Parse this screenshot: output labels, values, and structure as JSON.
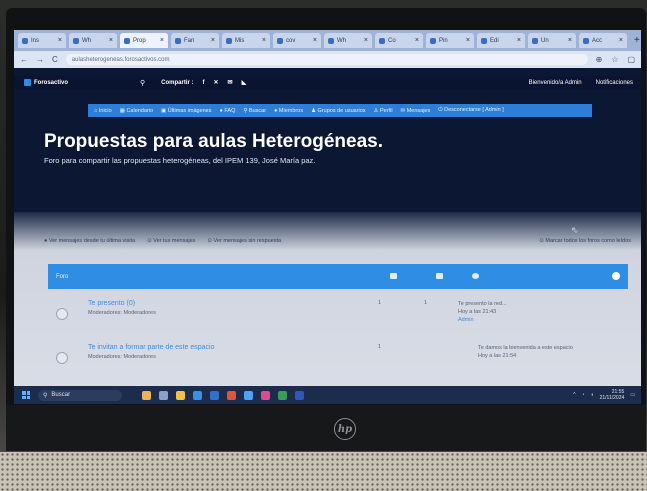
{
  "browser": {
    "tabs": [
      {
        "label": "Ins",
        "icon": "page-icon",
        "active": false
      },
      {
        "label": "Wh",
        "icon": "gmail-icon",
        "active": false
      },
      {
        "label": "Prop",
        "icon": "forum-icon",
        "active": true
      },
      {
        "label": "Fan",
        "icon": "page-icon",
        "active": false
      },
      {
        "label": "Mis",
        "icon": "page-icon",
        "active": false
      },
      {
        "label": "cov",
        "icon": "page-icon",
        "active": false
      },
      {
        "label": "Wh",
        "icon": "whatsapp-icon",
        "active": false
      },
      {
        "label": "Co",
        "icon": "page-icon",
        "active": false
      },
      {
        "label": "Pin",
        "icon": "page-icon",
        "active": false
      },
      {
        "label": "Edi",
        "icon": "page-icon",
        "active": false
      },
      {
        "label": "Un",
        "icon": "page-icon",
        "active": false
      },
      {
        "label": "Acc",
        "icon": "google-icon",
        "active": false
      }
    ],
    "new_tab": "+",
    "back": "←",
    "forward": "→",
    "reload": "C",
    "url": "aulasheterogeneas.forosactivos.com"
  },
  "topbar": {
    "brand": "Forosactivo",
    "search_icon": "⚲",
    "share_label": "Compartir :",
    "share_icons": [
      "f",
      "✕",
      "✉",
      "◣"
    ],
    "welcome": "Bienvenido/a Admin",
    "notifications": "Notificaciones"
  },
  "menu": [
    "Inicio",
    "Calendario",
    "Últimas imágenes",
    "FAQ",
    "Buscar",
    "Miembros",
    "Grupos de usuarios",
    "Perfil",
    "Mensajes",
    "Desconectarse [ Admin ]"
  ],
  "header": {
    "title": "Propuestas para aulas Heterogéneas.",
    "subtitle": "Foro para compartir las propuestas heterogéneas, del IPEM 139, José María paz."
  },
  "filters": {
    "left": [
      "Ver mensajes desde tu última visita",
      "Ver tus mensajes",
      "Ver mensajes sin respuesta"
    ],
    "right": "Marcar todos los foros como leídos"
  },
  "category": {
    "name": "Foro"
  },
  "forums": [
    {
      "title": "Te presento (0)",
      "moderators": "Moderadores: Moderadores",
      "topics": "1",
      "posts": "1",
      "last_title": "Te presento la red...",
      "last_date": "Hoy a las 21:43",
      "last_user": "Admin"
    },
    {
      "title": "Te invitan a formar parte de este espacio",
      "moderators": "Moderadores: Moderadores",
      "topics": "1",
      "posts": "",
      "last_title": "Te damos la bienvenida a este espacio",
      "last_date": "Hoy a las 21:54",
      "last_user": ""
    }
  ],
  "taskbar": {
    "search_placeholder": "Buscar",
    "time": "21:55",
    "date": "21/11/2024"
  }
}
